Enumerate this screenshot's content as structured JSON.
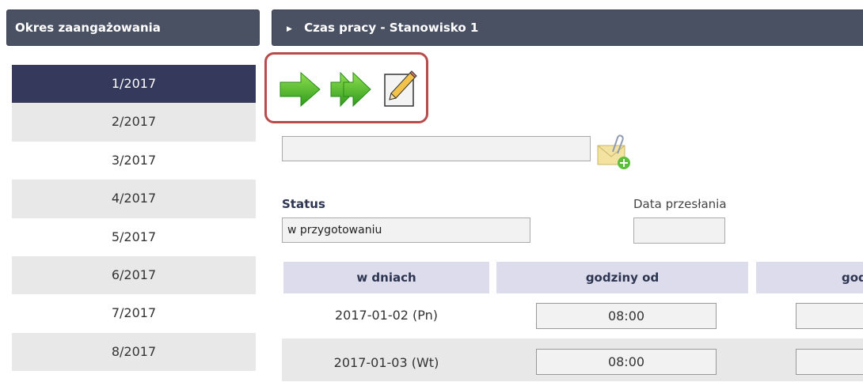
{
  "left_panel": {
    "title": "Okres zaangażowania",
    "periods": [
      "1/2017",
      "2/2017",
      "3/2017",
      "4/2017",
      "5/2017",
      "6/2017",
      "7/2017",
      "8/2017"
    ],
    "active_period": "1/2017"
  },
  "right_panel": {
    "title": "Czas pracy - Stanowisko 1"
  },
  "toolbar": {
    "icons": [
      "next-arrow-icon",
      "double-next-arrow-icon",
      "edit-pencil-icon"
    ]
  },
  "attachment": {
    "value": "",
    "icon": "mail-attachment-add-icon"
  },
  "status": {
    "label": "Status",
    "value": "w przygotowaniu"
  },
  "data_przeslania": {
    "label": "Data przesłania",
    "value": ""
  },
  "table": {
    "headers": [
      "w dniach",
      "godziny od",
      "god"
    ],
    "rows": [
      {
        "date": "2017-01-02 (Pn)",
        "from": "08:00"
      },
      {
        "date": "2017-01-03 (Wt)",
        "from": "08:00"
      }
    ]
  },
  "colors": {
    "header_bg": "#4a5163",
    "active_period_bg": "#353a5c",
    "highlight_border": "#b84c4c",
    "table_header_bg": "#dcdcec",
    "arrow_green": "#4cb82a"
  }
}
